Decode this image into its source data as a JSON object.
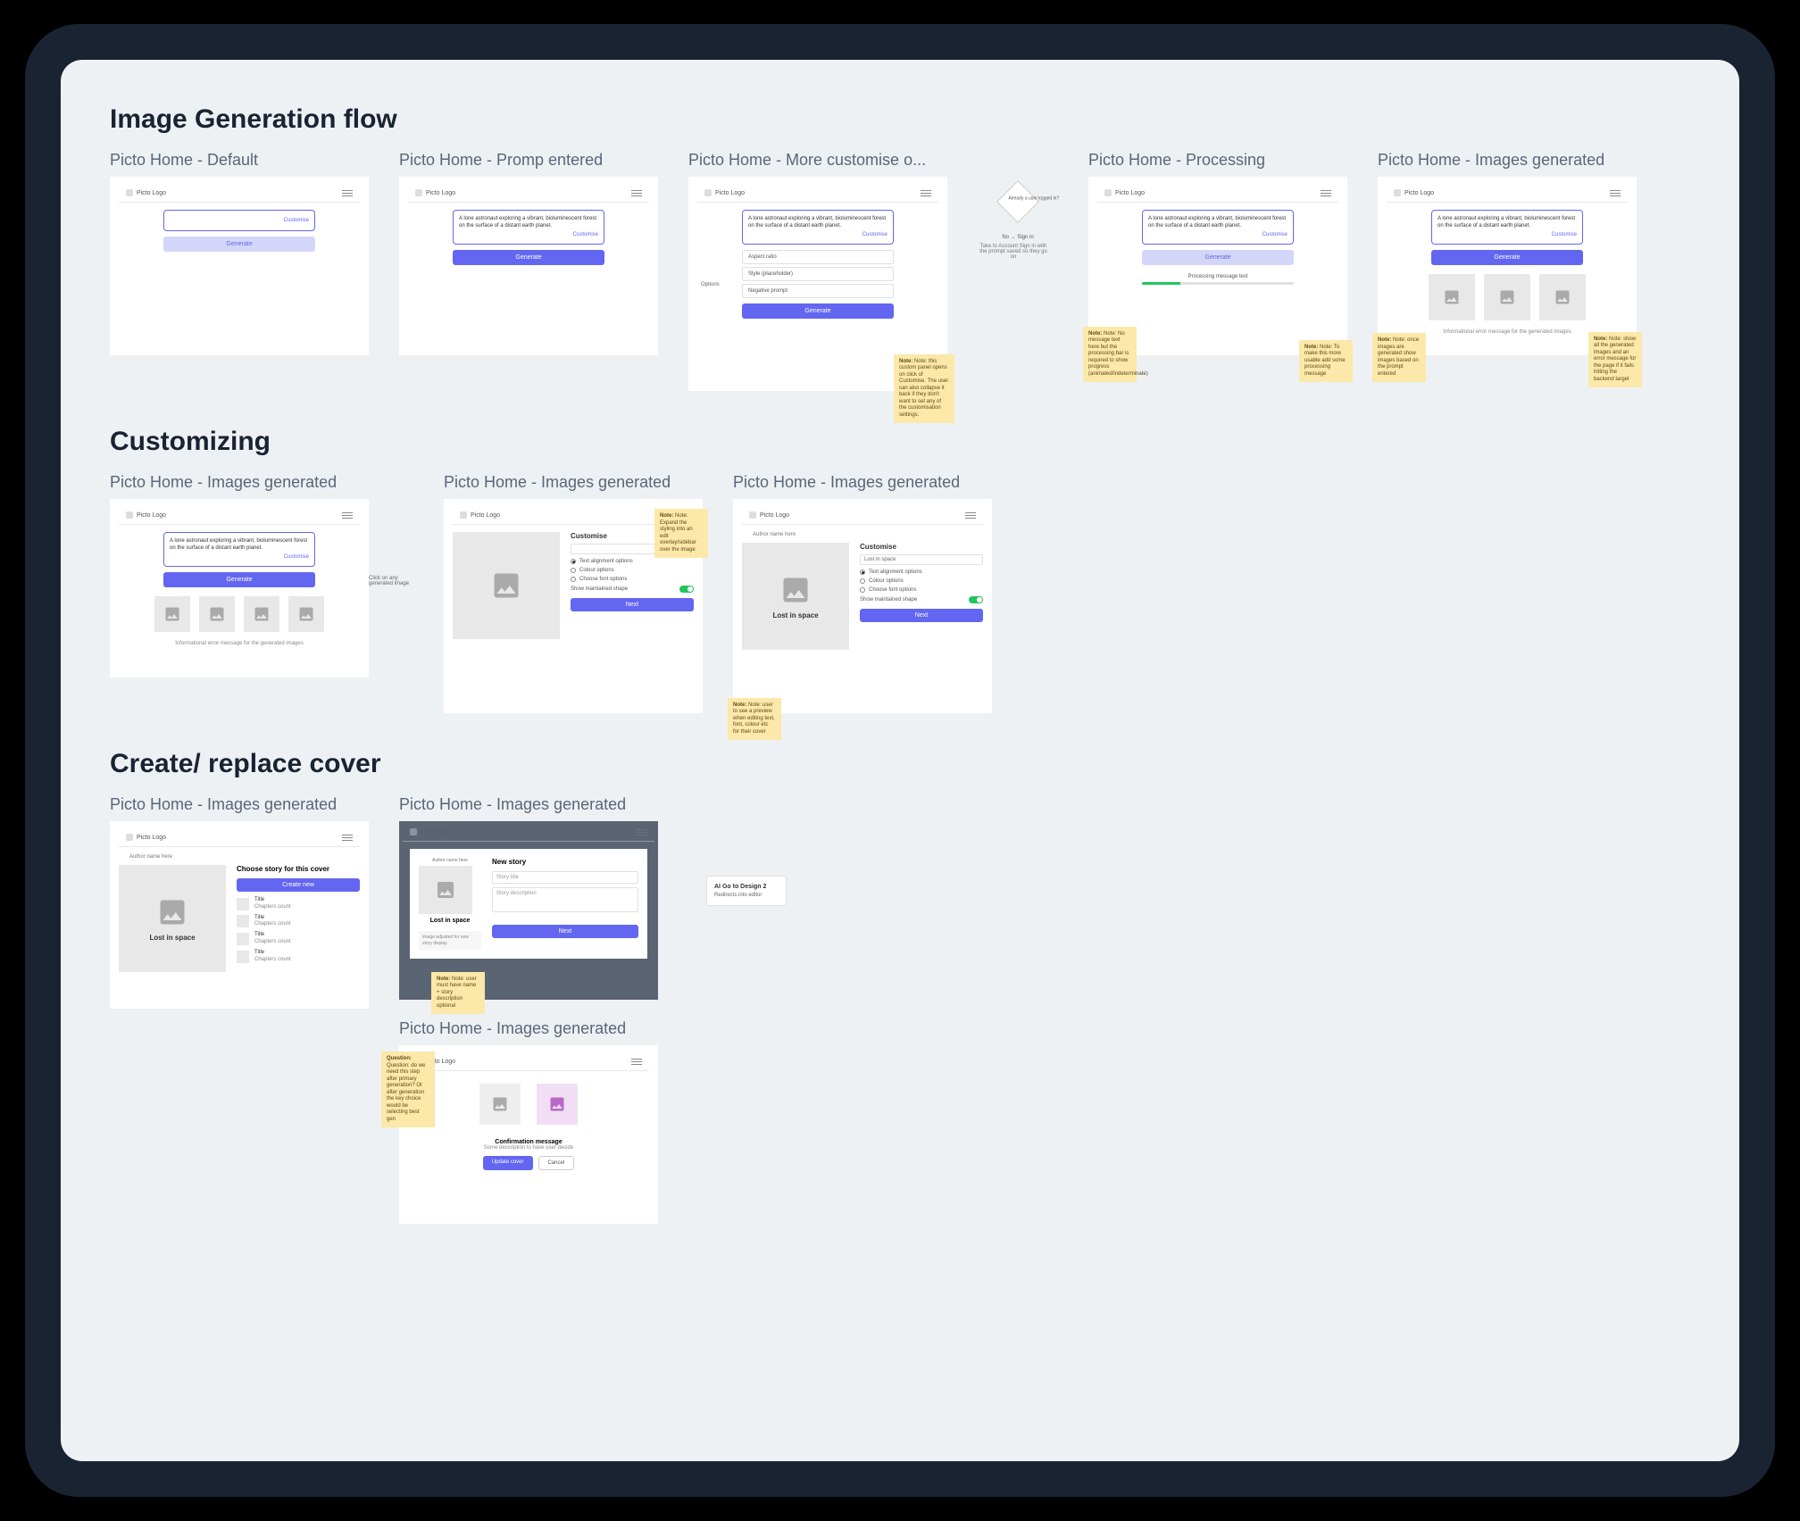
{
  "sections": {
    "flow1": "Image Generation flow",
    "flow2": "Customizing",
    "flow3": "Create/ replace cover"
  },
  "app": {
    "logo": "Picto Logo",
    "author": "Author name here"
  },
  "prompt_text": "A lone astronaut exploring a vibrant, bioluminescent forest on the surface of a distant earth planet.",
  "customise_link": "Customise",
  "generate_btn": "Generate",
  "options": {
    "o1": "Aspect ratio",
    "o2": "Style (placeholder)",
    "o3": "Negative prompt"
  },
  "processing": "Processing message text",
  "error": "Informational error message for the generated images",
  "customise": {
    "title": "Customise",
    "input": "Lost in space",
    "radio_align": "Text alignment options",
    "radio_colour": "Colour options",
    "radio_font": "Choose font options",
    "toggle": "Show maintained shape",
    "next": "Next"
  },
  "image_caption": "Lost in space",
  "click_any": "Click on any generated image",
  "story": {
    "title": "Choose story for this cover",
    "create": "Create new",
    "item_title": "Title",
    "item_chapters": "Chapters count"
  },
  "modal": {
    "title": "New story",
    "ph_title": "Story title",
    "ph_desc": "Story description",
    "note": "Image adjusted for new story display"
  },
  "confirm": {
    "title": "Confirmation message",
    "sub": "Some description to have user decide",
    "primary": "Update cover",
    "secondary": "Cancel"
  },
  "nodes": {
    "diamond": "Already a user logged in?",
    "no": "No",
    "sign_in": "Sign in",
    "yes_caption": "Take to Account Sign in with the prompt saved so they go on",
    "cta_title": "AI Go to Design 2",
    "cta_sub": "Redirects into editor"
  },
  "notes": {
    "n_customise": "Note: this custom panel opens on click of Customise. The user can also collapse it back if they don't want to set any of the customisation settings.",
    "n_proc1": "Note: No message text here but the processing bar is required to show progress (animated/indeterminate)",
    "n_proc2": "Note: To make this more usable add some processing message",
    "n_gen1": "Note: once images are generated show images based on the prompt entered",
    "n_gen2": "Note: show all the generated images and an error message for the page if it fails hitting the backend target",
    "n_cust_note": "Note: Expand the styling into an edit overlay/sidebar over the image",
    "n_cust_note2": "Note: user to see a preview when editing text, font, colour etc for their cover",
    "n_modal": "Note: user must have name + story description optional",
    "n_replace": "Question: do we need this step after primary generation? Or after generation the key choice would be selecting best gen"
  },
  "titles": {
    "t1": "Picto Home - Default",
    "t2": "Picto Home - Promp entered",
    "t3": "Picto Home - More customise o...",
    "t4": "Picto Home - Processing",
    "t5": "Picto Home - Images generated",
    "t6": "Picto Home - Images generated",
    "t7": "Picto Home - Images generated",
    "t8": "Picto Home - Images generated",
    "t9": "Picto Home - Images generated",
    "t10": "Picto Home - Images generated",
    "t11": "Picto Home - Images generated"
  }
}
